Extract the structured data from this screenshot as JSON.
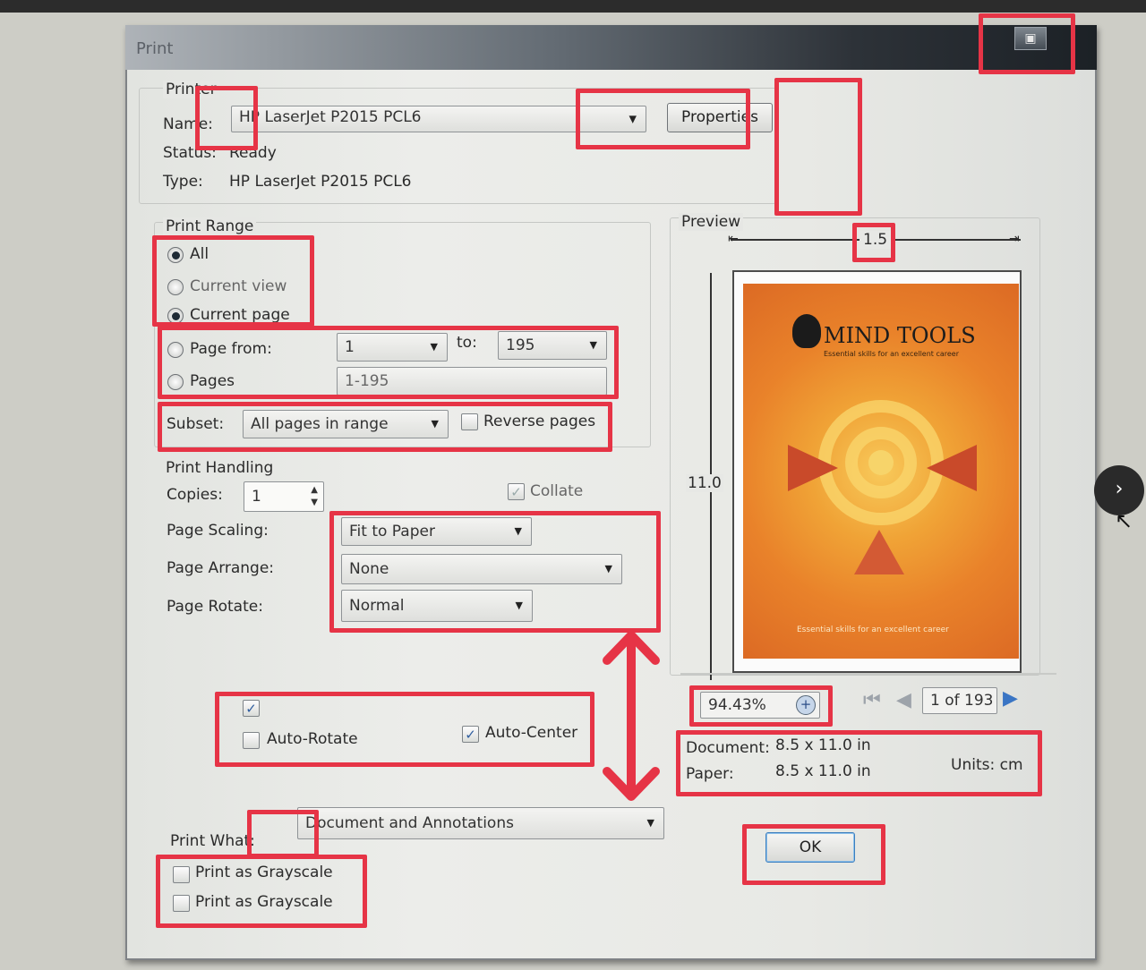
{
  "dialog": {
    "title": "Print",
    "maximize_glyph": "▣"
  },
  "printer": {
    "group_label": "Printer",
    "name_label": "Name:",
    "name_value": "HP LaserJet P2015 PCL6",
    "properties_label": "Properties",
    "status_label": "Status:",
    "status_value": "Ready",
    "type_label": "Type:",
    "type_value": "HP LaserJet P2015 PCL6"
  },
  "print_range": {
    "group_label": "Print Range",
    "all": "All",
    "current_view": "Current view",
    "current_page": "Current page",
    "page_from_label": "Page from:",
    "from_value": "1",
    "to_label": "to:",
    "to_value": "195",
    "pages_label": "Pages",
    "pages_value": "1-195",
    "subset_label": "Subset:",
    "subset_value": "All pages in range",
    "reverse_label": "Reverse pages"
  },
  "handling": {
    "group_label": "Print Handling",
    "copies_label": "Copies:",
    "copies_value": "1",
    "collate_label": "Collate",
    "scaling_label": "Page Scaling:",
    "scaling_value": "Fit to Paper",
    "arrange_label": "Page Arrange:",
    "arrange_value": "None",
    "rotate_label": "Page Rotate:",
    "rotate_value": "Normal",
    "auto_rotate_label": "Auto-Rotate",
    "auto_center_label": "Auto-Center"
  },
  "print_what": {
    "label": "Print What:",
    "value": "Document and Annotations",
    "grayscale_1": "Print as Grayscale",
    "grayscale_2": "Print as Grayscale"
  },
  "preview": {
    "label": "Preview",
    "width_value": "1.5",
    "height_value": "11.0",
    "cover_brand": "MIND TOOLS",
    "cover_tagline": "Essential skills for an excellent career",
    "cover_footer": "Essential skills for an excellent career",
    "zoom": "94.43%",
    "page_indicator": "1 of 193",
    "document_label": "Document:",
    "document_size": "8.5 x 11.0 in",
    "paper_label": "Paper:",
    "paper_size": "8.5 x 11.0 in",
    "units": "Units: cm"
  },
  "buttons": {
    "ok": "OK"
  },
  "side": {
    "next_glyph": "›"
  },
  "annotations": {
    "color": "#e63446"
  }
}
